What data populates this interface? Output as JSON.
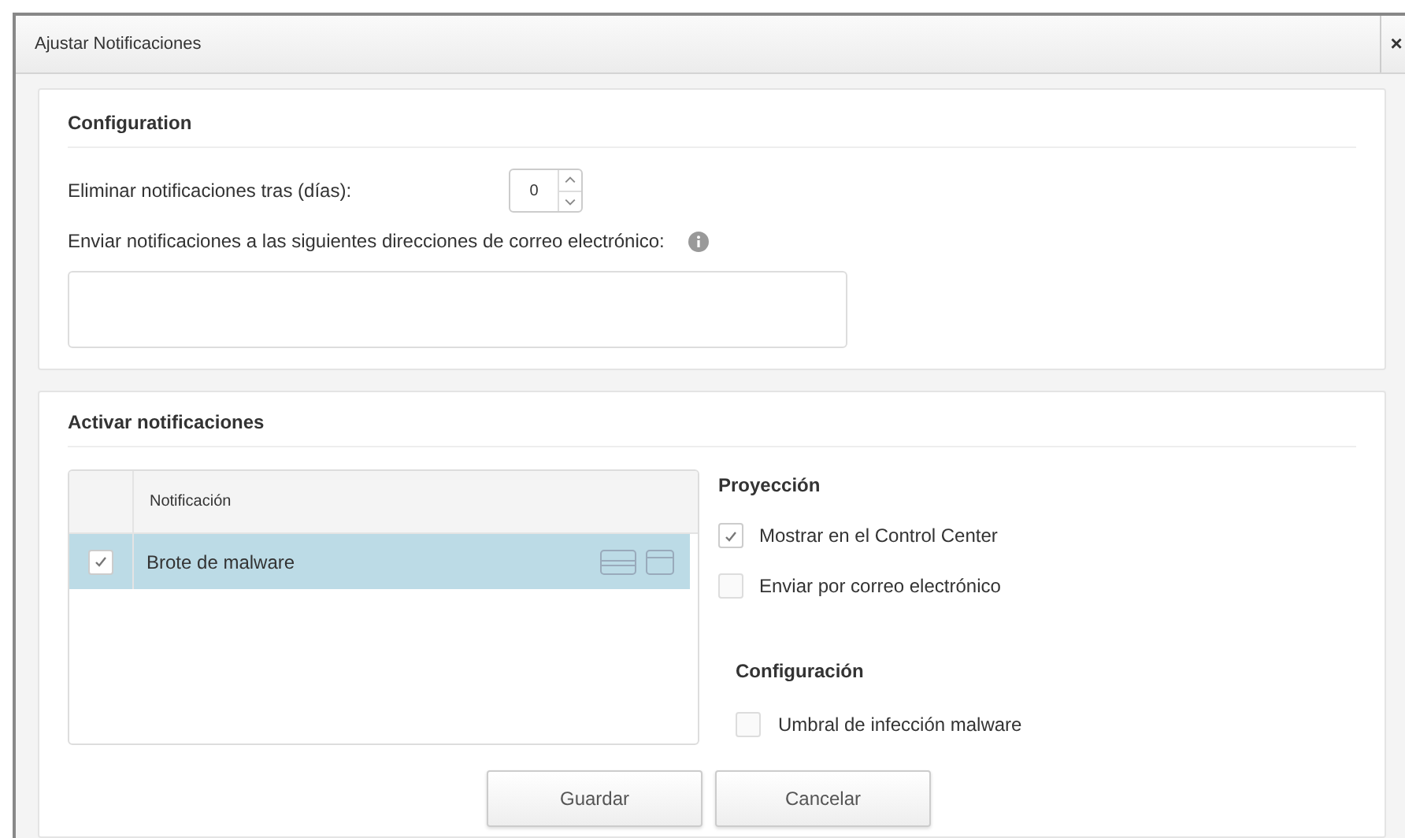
{
  "window": {
    "title": "Ajustar Notificaciones",
    "close": "×"
  },
  "configuration": {
    "heading": "Configuration",
    "delete_after_label": "Eliminar notificaciones tras (días):",
    "delete_after_value": "0",
    "email_label": "Enviar notificaciones a las siguientes direcciones de correo electrónico:"
  },
  "activate": {
    "heading": "Activar notificaciones",
    "table": {
      "columns": [
        "Notificación"
      ],
      "rows": [
        {
          "name": "Brote de malware",
          "checked": true,
          "selected": true
        }
      ]
    },
    "projection": {
      "heading": "Proyección",
      "options": [
        {
          "label": "Mostrar en el Control Center",
          "checked": true
        },
        {
          "label": "Enviar por correo electrónico",
          "checked": false
        }
      ]
    },
    "settings": {
      "heading": "Configuración",
      "options": [
        {
          "label": "Umbral de infección malware",
          "checked": false
        }
      ]
    }
  },
  "buttons": [
    "Guardar",
    "Cancelar"
  ]
}
